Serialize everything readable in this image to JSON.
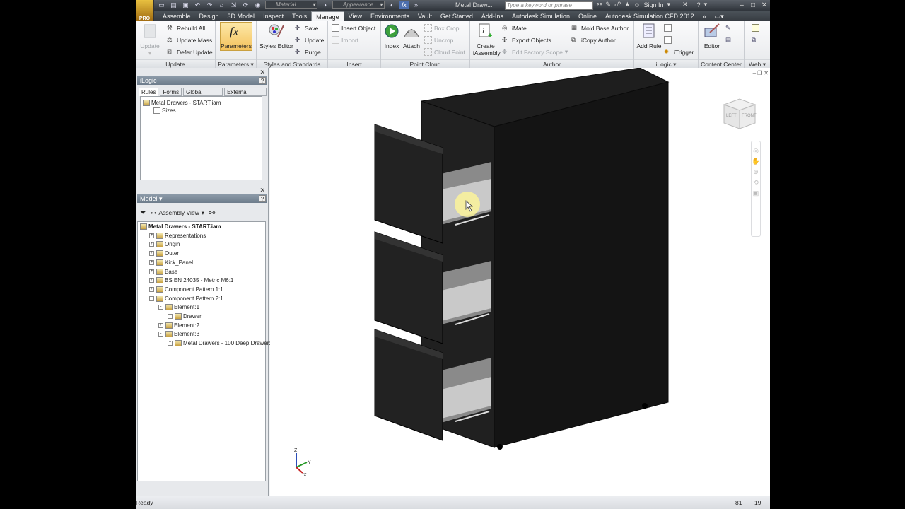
{
  "app": {
    "logo_text": "PRO",
    "document_title": "Metal Draw...",
    "search_placeholder": "Type a keyword or phrase",
    "material_combo": "Material",
    "appearance_combo": "Appearance",
    "sign_in": "Sign In"
  },
  "tabs": [
    "Assemble",
    "Design",
    "3D Model",
    "Inspect",
    "Tools",
    "Manage",
    "View",
    "Environments",
    "Vault",
    "Get Started",
    "Add-Ins",
    "Autodesk Simulation",
    "Online",
    "Autodesk Simulation CFD 2012"
  ],
  "active_tab": "Manage",
  "ribbon": {
    "update": {
      "big": "Update",
      "rebuild_all": "Rebuild All",
      "update_mass": "Update Mass",
      "defer_update": "Defer Update",
      "label": "Update"
    },
    "parameters": {
      "big": "Parameters",
      "label": "Parameters"
    },
    "styles": {
      "big": "Styles Editor",
      "save": "Save",
      "update": "Update",
      "purge": "Purge",
      "label": "Styles and Standards"
    },
    "insert": {
      "insert_object": "Insert Object",
      "import": "Import",
      "label": "Insert"
    },
    "point_cloud": {
      "index": "Index",
      "attach": "Attach",
      "box_crop": "Box Crop",
      "uncrop": "Uncrop",
      "cloud_point": "Cloud Point",
      "label": "Point Cloud"
    },
    "author": {
      "create_iassembly_1": "Create",
      "create_iassembly_2": "iAssembly",
      "imate": "iMate",
      "export_objects": "Export Objects",
      "edit_factory_scope": "Edit Factory Scope",
      "mold_base_author": "Mold Base Author",
      "icopy_author": "iCopy Author",
      "label": "Author"
    },
    "ilogic": {
      "add_rule": "Add Rule",
      "itrigger": "iTrigger",
      "label": "iLogic"
    },
    "content_center": {
      "editor": "Editor",
      "label": "Content Center"
    },
    "web": {
      "label": "Web"
    }
  },
  "ilogic_panel": {
    "title": "iLogic",
    "tabs": [
      "Rules",
      "Forms",
      "Global Forms",
      "External Rules"
    ],
    "tree_root": "Metal Drawers - START.iam",
    "tree_child": "Sizes"
  },
  "model_panel": {
    "title": "Model",
    "view_combo": "Assembly View",
    "tree": [
      {
        "label": "Metal Drawers - START.iam",
        "depth": 0,
        "expander": ""
      },
      {
        "label": "Representations",
        "depth": 1,
        "expander": "+"
      },
      {
        "label": "Origin",
        "depth": 1,
        "expander": "+"
      },
      {
        "label": "Outer",
        "depth": 1,
        "expander": "+"
      },
      {
        "label": "Kick_Panel",
        "depth": 1,
        "expander": "+"
      },
      {
        "label": "Base",
        "depth": 1,
        "expander": "+"
      },
      {
        "label": "BS EN 24035 - Metric M6:1",
        "depth": 1,
        "expander": "+"
      },
      {
        "label": "Component Pattern 1:1",
        "depth": 1,
        "expander": "+"
      },
      {
        "label": "Component Pattern 2:1",
        "depth": 1,
        "expander": "-"
      },
      {
        "label": "Element:1",
        "depth": 2,
        "expander": "-"
      },
      {
        "label": "Drawer",
        "depth": 3,
        "expander": "+"
      },
      {
        "label": "Element:2",
        "depth": 2,
        "expander": "+"
      },
      {
        "label": "Element:3",
        "depth": 2,
        "expander": "-"
      },
      {
        "label": "Metal Drawers - 100 Deep Drawer:3",
        "depth": 3,
        "expander": "+"
      }
    ]
  },
  "viewcube": {
    "left": "LEFT",
    "front": "FRONT"
  },
  "axes": {
    "x": "X",
    "y": "Y",
    "z": "Z"
  },
  "status": {
    "text": "Ready",
    "num1": "81",
    "num2": "19"
  }
}
